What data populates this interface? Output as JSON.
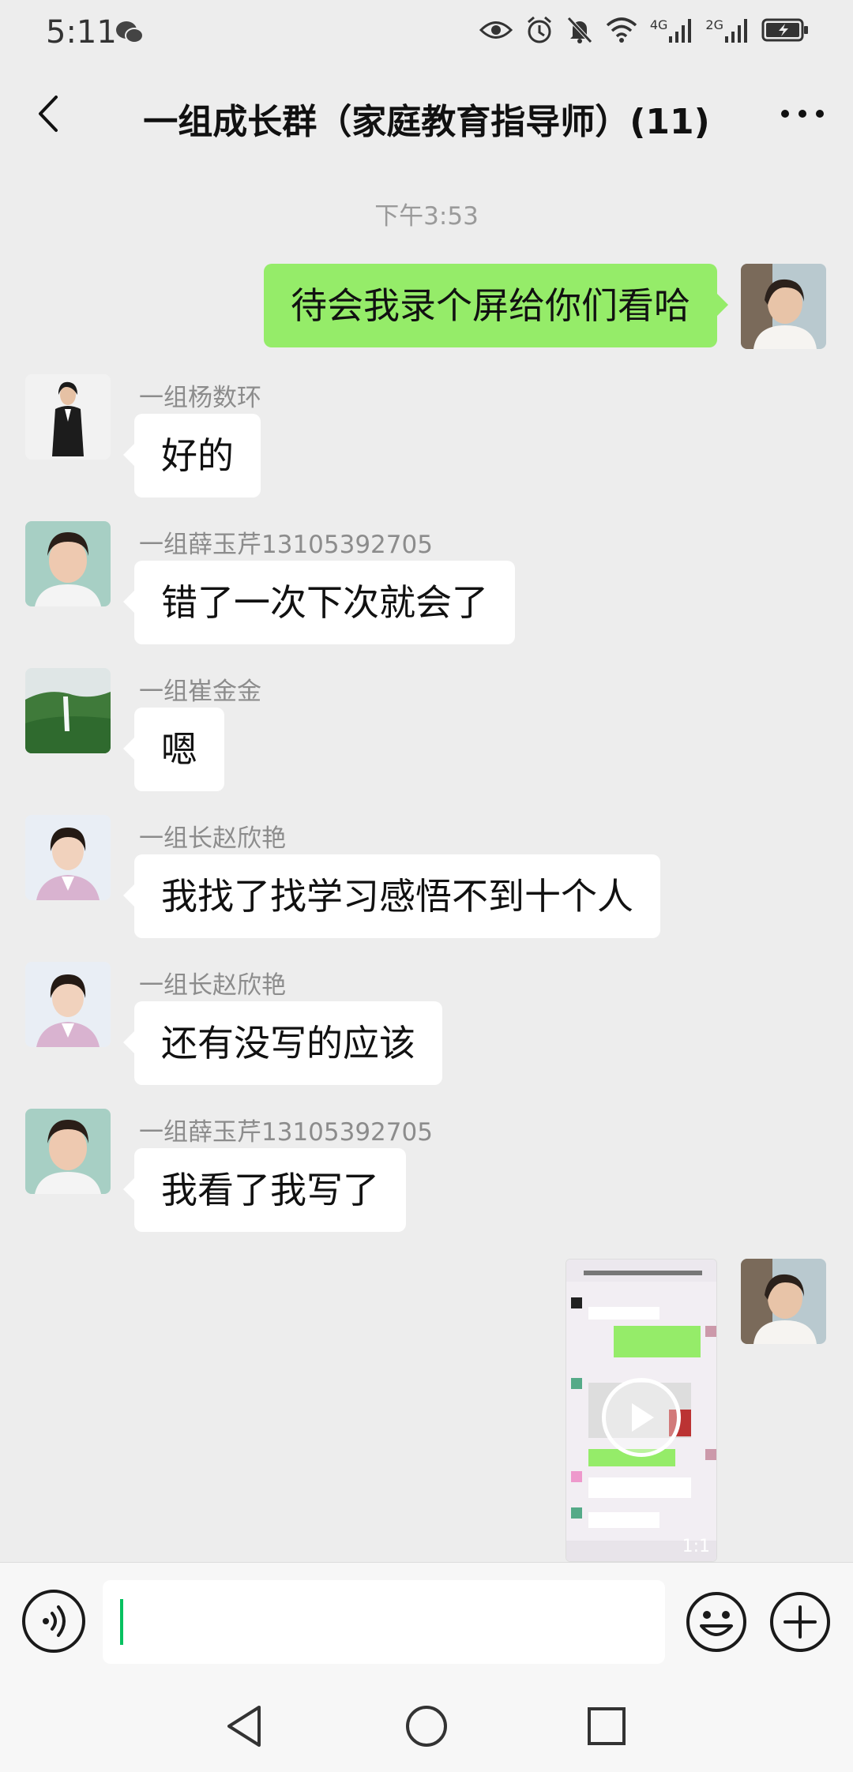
{
  "status_bar": {
    "time": "5:11",
    "network_a": "4G",
    "network_b": "2G"
  },
  "header": {
    "title": "一组成长群（家庭教育指导师）(11)"
  },
  "chat": {
    "timestamp": "下午3:53",
    "messages": [
      {
        "side": "right",
        "text": "待会我录个屏给你们看哈"
      },
      {
        "side": "left",
        "sender": "一组杨数环",
        "text": "好的"
      },
      {
        "side": "left",
        "sender": "一组薛玉芹13105392705",
        "text": "错了一次下次就会了"
      },
      {
        "side": "left",
        "sender": "一组崔金金",
        "text": "嗯"
      },
      {
        "side": "left",
        "sender": "一组长赵欣艳",
        "text": "我找了找学习感悟不到十个人"
      },
      {
        "side": "left",
        "sender": "一组长赵欣艳",
        "text": "还有没写的应该"
      },
      {
        "side": "left",
        "sender": "一组薛玉芹13105392705",
        "text": "我看了我写了"
      }
    ],
    "video": {
      "duration": "1:1"
    }
  },
  "input": {
    "value": ""
  },
  "colors": {
    "accent": "#07c160",
    "bubble_self": "#95ec69",
    "background": "#ededed"
  },
  "icons": [
    "back-arrow-icon",
    "more-icon",
    "voice-icon",
    "emoji-icon",
    "plus-icon",
    "nav-back-icon",
    "nav-home-icon",
    "nav-recents-icon"
  ]
}
